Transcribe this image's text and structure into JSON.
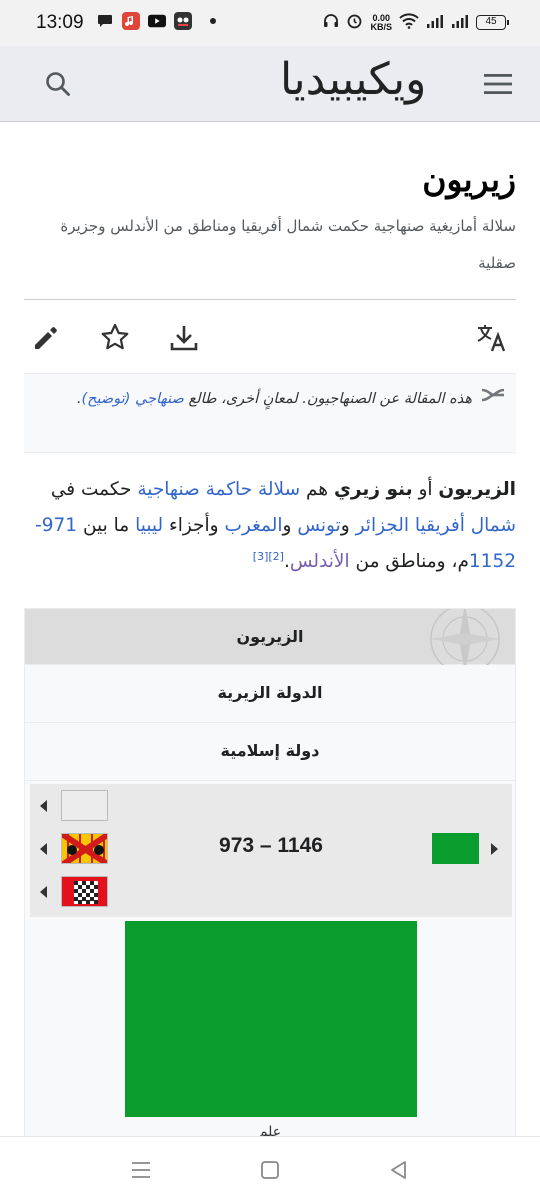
{
  "status_bar": {
    "time": "13:09",
    "net_speed_value": "0.00",
    "net_speed_unit": "KB/S",
    "battery": "45"
  },
  "header": {
    "logo": "ويكيبيديا",
    "search_icon": "search-icon",
    "menu_icon": "hamburger-menu-icon"
  },
  "article": {
    "title": "زيريون",
    "subtitle": "سلالة أمازيغية صنهاجية حكمت شمال أفريقيا ومناطق من الأندلس وجزيرة صقلية"
  },
  "actions": {
    "language_icon": "language-icon",
    "download_icon": "download-icon",
    "watch_icon": "star-icon",
    "edit_icon": "pencil-icon"
  },
  "hatnote": {
    "text_before": "هذه المقالة عن الصنهاجيون. لمعانٍ أخرى، طالع ",
    "link": "صنهاجي (توضيح)",
    "text_after": "."
  },
  "intro": {
    "bold1": "الزيريون",
    "t1": " أو ",
    "bold2": "بنو زيري",
    "t2": " هم ",
    "l1": "سلالة حاكمة صنهاجية",
    "t3": " حكمت في ",
    "l2": "شمال أفريقيا",
    "t4": " ",
    "l3": "الجزائر",
    "t5": " و",
    "l4": "تونس",
    "t6": " و",
    "l5": "المغرب",
    "t7": " وأجزاء ",
    "l6": "ليبيا",
    "t8": " ما بين ",
    "l7": "971-1152",
    "t9": "م، ومناطق من ",
    "l8": "الأندلس",
    "t10": ".",
    "ref1": "[2]",
    "ref2": "[3]"
  },
  "infobox": {
    "header": "الزيريون",
    "row1": "الدولة الزيرية",
    "row2": "دولة إسلامية",
    "years": "973 – 1146",
    "caption_partial": "علم"
  },
  "colors": {
    "link": "#3366cc",
    "visited_link": "#795cb2",
    "flag_green": "#0a9c2d"
  },
  "nav": {
    "recents_icon": "recents-icon",
    "home_icon": "home-icon",
    "back_icon": "back-icon"
  }
}
